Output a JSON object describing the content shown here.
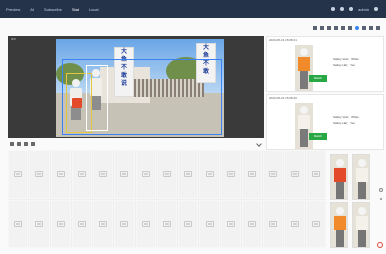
{
  "nav": {
    "items": [
      "Preview",
      "AI",
      "Subscribe",
      "Stat",
      "Local"
    ],
    "active_index": 3,
    "user": "admin"
  },
  "video": {
    "label": "IPC",
    "sign_left": [
      "大",
      "鱼",
      "不",
      "敢",
      "说"
    ],
    "sign_right": [
      "大",
      "鱼",
      "不",
      "敢"
    ]
  },
  "alerts": [
    {
      "time": "2023-05-19 15:08:41",
      "tag": "Match",
      "line1": "Safety Vest：White",
      "line2": "Safety Hat：Yes"
    },
    {
      "time": "2023-05-19 15:08:40",
      "tag": "Match",
      "line1": "Safety Vest：White",
      "line2": "Safety Hat：Yes"
    }
  ],
  "colors": {
    "nav_bg": "#24324a",
    "accent": "#3b82f6",
    "match": "#28a745",
    "vest": "#e24a2a"
  }
}
